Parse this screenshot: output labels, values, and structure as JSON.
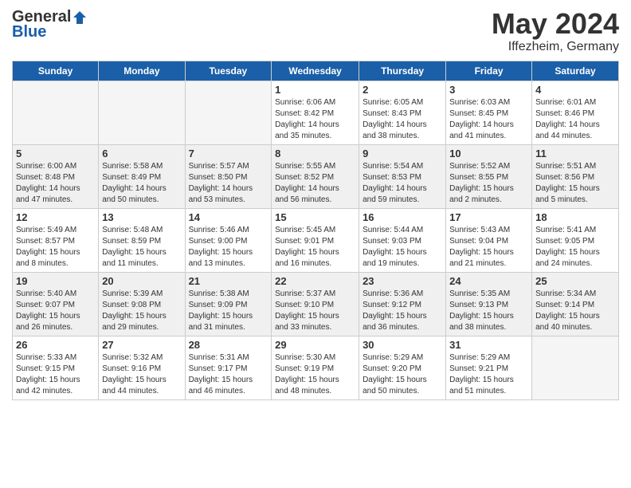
{
  "logo": {
    "general": "General",
    "blue": "Blue"
  },
  "header": {
    "month_year": "May 2024",
    "location": "Iffezheim, Germany"
  },
  "days_of_week": [
    "Sunday",
    "Monday",
    "Tuesday",
    "Wednesday",
    "Thursday",
    "Friday",
    "Saturday"
  ],
  "weeks": [
    [
      {
        "day": "",
        "info": ""
      },
      {
        "day": "",
        "info": ""
      },
      {
        "day": "",
        "info": ""
      },
      {
        "day": "1",
        "info": "Sunrise: 6:06 AM\nSunset: 8:42 PM\nDaylight: 14 hours\nand 35 minutes."
      },
      {
        "day": "2",
        "info": "Sunrise: 6:05 AM\nSunset: 8:43 PM\nDaylight: 14 hours\nand 38 minutes."
      },
      {
        "day": "3",
        "info": "Sunrise: 6:03 AM\nSunset: 8:45 PM\nDaylight: 14 hours\nand 41 minutes."
      },
      {
        "day": "4",
        "info": "Sunrise: 6:01 AM\nSunset: 8:46 PM\nDaylight: 14 hours\nand 44 minutes."
      }
    ],
    [
      {
        "day": "5",
        "info": "Sunrise: 6:00 AM\nSunset: 8:48 PM\nDaylight: 14 hours\nand 47 minutes."
      },
      {
        "day": "6",
        "info": "Sunrise: 5:58 AM\nSunset: 8:49 PM\nDaylight: 14 hours\nand 50 minutes."
      },
      {
        "day": "7",
        "info": "Sunrise: 5:57 AM\nSunset: 8:50 PM\nDaylight: 14 hours\nand 53 minutes."
      },
      {
        "day": "8",
        "info": "Sunrise: 5:55 AM\nSunset: 8:52 PM\nDaylight: 14 hours\nand 56 minutes."
      },
      {
        "day": "9",
        "info": "Sunrise: 5:54 AM\nSunset: 8:53 PM\nDaylight: 14 hours\nand 59 minutes."
      },
      {
        "day": "10",
        "info": "Sunrise: 5:52 AM\nSunset: 8:55 PM\nDaylight: 15 hours\nand 2 minutes."
      },
      {
        "day": "11",
        "info": "Sunrise: 5:51 AM\nSunset: 8:56 PM\nDaylight: 15 hours\nand 5 minutes."
      }
    ],
    [
      {
        "day": "12",
        "info": "Sunrise: 5:49 AM\nSunset: 8:57 PM\nDaylight: 15 hours\nand 8 minutes."
      },
      {
        "day": "13",
        "info": "Sunrise: 5:48 AM\nSunset: 8:59 PM\nDaylight: 15 hours\nand 11 minutes."
      },
      {
        "day": "14",
        "info": "Sunrise: 5:46 AM\nSunset: 9:00 PM\nDaylight: 15 hours\nand 13 minutes."
      },
      {
        "day": "15",
        "info": "Sunrise: 5:45 AM\nSunset: 9:01 PM\nDaylight: 15 hours\nand 16 minutes."
      },
      {
        "day": "16",
        "info": "Sunrise: 5:44 AM\nSunset: 9:03 PM\nDaylight: 15 hours\nand 19 minutes."
      },
      {
        "day": "17",
        "info": "Sunrise: 5:43 AM\nSunset: 9:04 PM\nDaylight: 15 hours\nand 21 minutes."
      },
      {
        "day": "18",
        "info": "Sunrise: 5:41 AM\nSunset: 9:05 PM\nDaylight: 15 hours\nand 24 minutes."
      }
    ],
    [
      {
        "day": "19",
        "info": "Sunrise: 5:40 AM\nSunset: 9:07 PM\nDaylight: 15 hours\nand 26 minutes."
      },
      {
        "day": "20",
        "info": "Sunrise: 5:39 AM\nSunset: 9:08 PM\nDaylight: 15 hours\nand 29 minutes."
      },
      {
        "day": "21",
        "info": "Sunrise: 5:38 AM\nSunset: 9:09 PM\nDaylight: 15 hours\nand 31 minutes."
      },
      {
        "day": "22",
        "info": "Sunrise: 5:37 AM\nSunset: 9:10 PM\nDaylight: 15 hours\nand 33 minutes."
      },
      {
        "day": "23",
        "info": "Sunrise: 5:36 AM\nSunset: 9:12 PM\nDaylight: 15 hours\nand 36 minutes."
      },
      {
        "day": "24",
        "info": "Sunrise: 5:35 AM\nSunset: 9:13 PM\nDaylight: 15 hours\nand 38 minutes."
      },
      {
        "day": "25",
        "info": "Sunrise: 5:34 AM\nSunset: 9:14 PM\nDaylight: 15 hours\nand 40 minutes."
      }
    ],
    [
      {
        "day": "26",
        "info": "Sunrise: 5:33 AM\nSunset: 9:15 PM\nDaylight: 15 hours\nand 42 minutes."
      },
      {
        "day": "27",
        "info": "Sunrise: 5:32 AM\nSunset: 9:16 PM\nDaylight: 15 hours\nand 44 minutes."
      },
      {
        "day": "28",
        "info": "Sunrise: 5:31 AM\nSunset: 9:17 PM\nDaylight: 15 hours\nand 46 minutes."
      },
      {
        "day": "29",
        "info": "Sunrise: 5:30 AM\nSunset: 9:19 PM\nDaylight: 15 hours\nand 48 minutes."
      },
      {
        "day": "30",
        "info": "Sunrise: 5:29 AM\nSunset: 9:20 PM\nDaylight: 15 hours\nand 50 minutes."
      },
      {
        "day": "31",
        "info": "Sunrise: 5:29 AM\nSunset: 9:21 PM\nDaylight: 15 hours\nand 51 minutes."
      },
      {
        "day": "",
        "info": ""
      }
    ]
  ]
}
